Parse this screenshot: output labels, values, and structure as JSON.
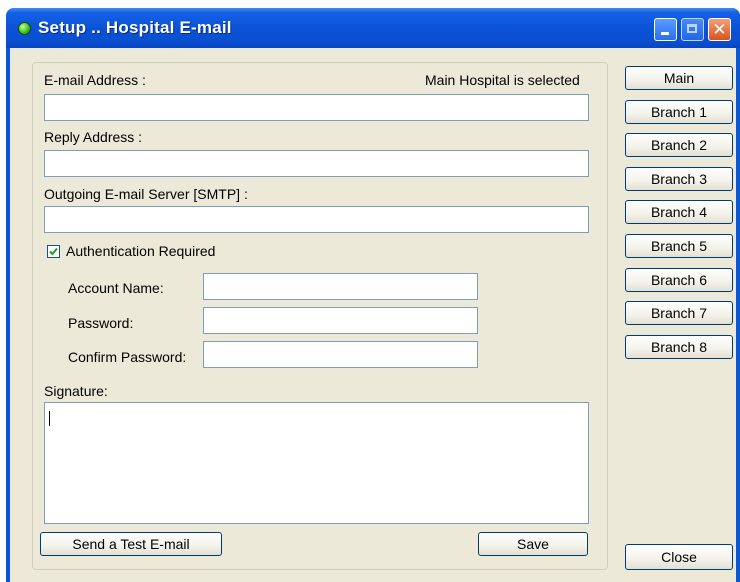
{
  "window": {
    "title": "Setup .. Hospital E-mail"
  },
  "form": {
    "email_label": "E-mail Address :",
    "selection_status": "Main Hospital is selected",
    "email_value": "",
    "reply_label": "Reply Address :",
    "reply_value": "",
    "smtp_label": "Outgoing E-mail Server [SMTP] :",
    "smtp_value": "",
    "auth_label": "Authentication Required",
    "auth_checked": true,
    "account_label": "Account Name:",
    "account_value": "",
    "password_label": "Password:",
    "password_value": "",
    "confirm_label": "Confirm Password:",
    "confirm_value": "",
    "signature_label": "Signature:",
    "signature_value": ""
  },
  "buttons": {
    "test_email": "Send a Test E-mail",
    "save": "Save",
    "close": "Close"
  },
  "branches": [
    "Main",
    "Branch 1",
    "Branch 2",
    "Branch 3",
    "Branch 4",
    "Branch 5",
    "Branch 6",
    "Branch 7",
    "Branch 8"
  ]
}
